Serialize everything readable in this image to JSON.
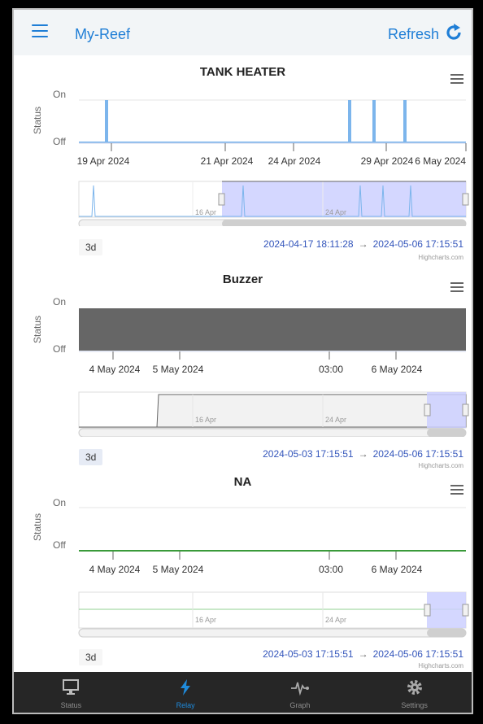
{
  "header": {
    "title": "My-Reef",
    "refresh_label": "Refresh",
    "menu_icon": "hamburger-menu-icon",
    "refresh_icon": "refresh-icon"
  },
  "colors": {
    "accent": "#1f7ed6",
    "series": "#7cb5ec",
    "navigator_fill": "#ccd0ff",
    "buzzer_fill": "#666666",
    "na_line": "#3a9a3a"
  },
  "ylabel": "Status",
  "ytick_on": "On",
  "ytick_off": "Off",
  "nav_tick_1": "16 Apr",
  "nav_tick_2": "24 Apr",
  "arrow": "→",
  "credits": "Highcharts.com",
  "charts": [
    {
      "title": "TANK HEATER",
      "xticks": [
        "19 Apr 2024",
        "21 Apr 2024",
        "24 Apr 2024",
        "29 Apr 2024",
        "6 May 2024"
      ],
      "range_button": "3d",
      "range_from": "2024-04-17 18:11:28",
      "range_to": "2024-05-06 17:15:51"
    },
    {
      "title": "Buzzer",
      "xticks": [
        "4 May 2024",
        "5 May 2024",
        "03:00",
        "6 May 2024"
      ],
      "range_button": "3d",
      "range_from": "2024-05-03 17:15:51",
      "range_to": "2024-05-06 17:15:51"
    },
    {
      "title": "NA",
      "xticks": [
        "4 May 2024",
        "5 May 2024",
        "03:00",
        "6 May 2024"
      ],
      "range_button": "3d",
      "range_from": "2024-05-03 17:15:51",
      "range_to": "2024-05-06 17:15:51"
    }
  ],
  "chart_data": [
    {
      "type": "line",
      "title": "TANK HEATER",
      "ylabel": "Status",
      "yticks": [
        "Off",
        "On"
      ],
      "x": [
        "2024-04-19",
        "2024-04-28",
        "2024-04-29",
        "2024-05-01"
      ],
      "y": [
        1,
        1,
        1,
        1
      ]
    },
    {
      "type": "area",
      "title": "Buzzer",
      "ylabel": "Status",
      "yticks": [
        "Off",
        "On"
      ],
      "x": [
        "2024-05-03 17:15:51",
        "2024-05-06 17:15:51"
      ],
      "y": [
        1,
        1
      ]
    },
    {
      "type": "line",
      "title": "NA",
      "ylabel": "Status",
      "yticks": [
        "Off",
        "On"
      ],
      "x": [
        "2024-05-03 17:15:51",
        "2024-05-06 17:15:51"
      ],
      "y": [
        0,
        0
      ]
    }
  ],
  "nav": [
    {
      "label": "Status",
      "icon": "monitor-icon"
    },
    {
      "label": "Relay",
      "icon": "lightning-icon"
    },
    {
      "label": "Graph",
      "icon": "pulse-graph-icon"
    },
    {
      "label": "Settings",
      "icon": "gear-icon"
    }
  ]
}
